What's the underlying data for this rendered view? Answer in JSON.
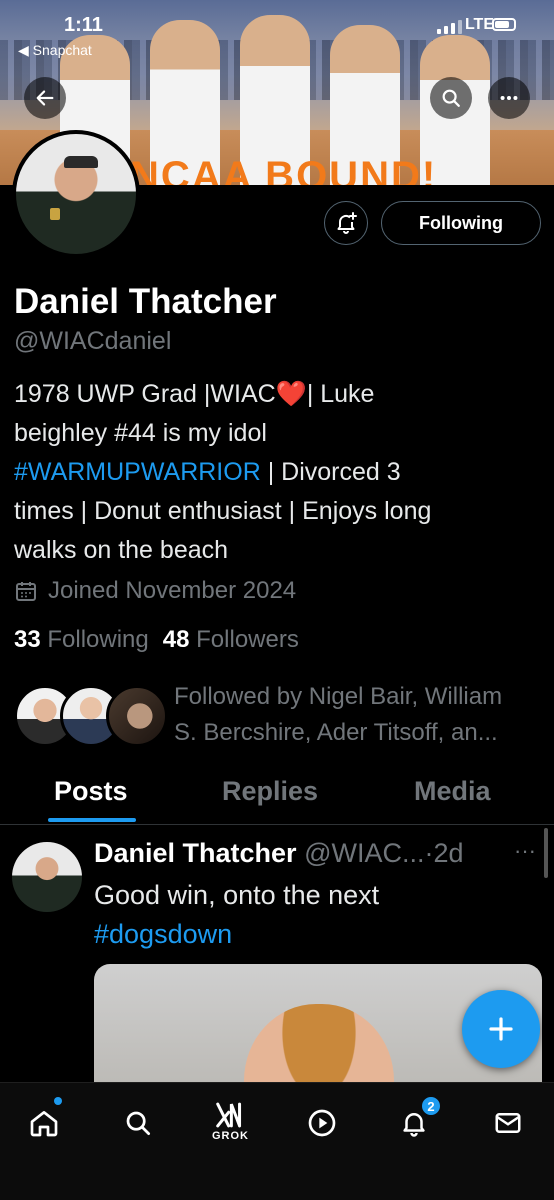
{
  "status_bar": {
    "time": "1:11",
    "back_app": "◀ Snapchat",
    "network": "LTE"
  },
  "banner": {
    "overlay_text": "NCAA BOUND!"
  },
  "profile": {
    "name": "Daniel Thatcher",
    "handle": "@WIACdaniel",
    "bio_line1_a": "1978 UWP Grad |WIAC",
    "bio_line1_heart": "❤️",
    "bio_line1_b": "| Luke",
    "bio_line2": "beighley #44 is my idol",
    "bio_hashtag": "#WARMUPWARRIOR",
    "bio_line3_rest": " | Divorced 3",
    "bio_line4": "times | Donut enthusiast | Enjoys long",
    "bio_line5": "walks on the beach",
    "joined": "Joined November 2024",
    "following_count": "33",
    "following_label": "Following",
    "followers_count": "48",
    "followers_label": "Followers",
    "followed_by_line1": "Followed by Nigel Bair, William",
    "followed_by_line2": "S. Bercshire, Ader Titsoff, an..."
  },
  "actions": {
    "following_button": "Following"
  },
  "tabs": [
    {
      "label": "Posts",
      "active": true
    },
    {
      "label": "Replies",
      "active": false
    },
    {
      "label": "Media",
      "active": false
    }
  ],
  "post": {
    "author": "Daniel Thatcher",
    "handle_time": "@WIAC...·2d",
    "more": "···",
    "text": "Good win, onto the next",
    "hashtag": "#dogsdown"
  },
  "bottom_nav": {
    "items": [
      "home-icon",
      "search-icon",
      "grok-icon",
      "play-icon",
      "bell-icon",
      "mail-icon"
    ],
    "grok_label": "GROK",
    "notification_count": "2"
  },
  "colors": {
    "accent": "#1d9bf0",
    "muted": "#71767b",
    "background": "#000000",
    "heart": "#f4212e"
  }
}
